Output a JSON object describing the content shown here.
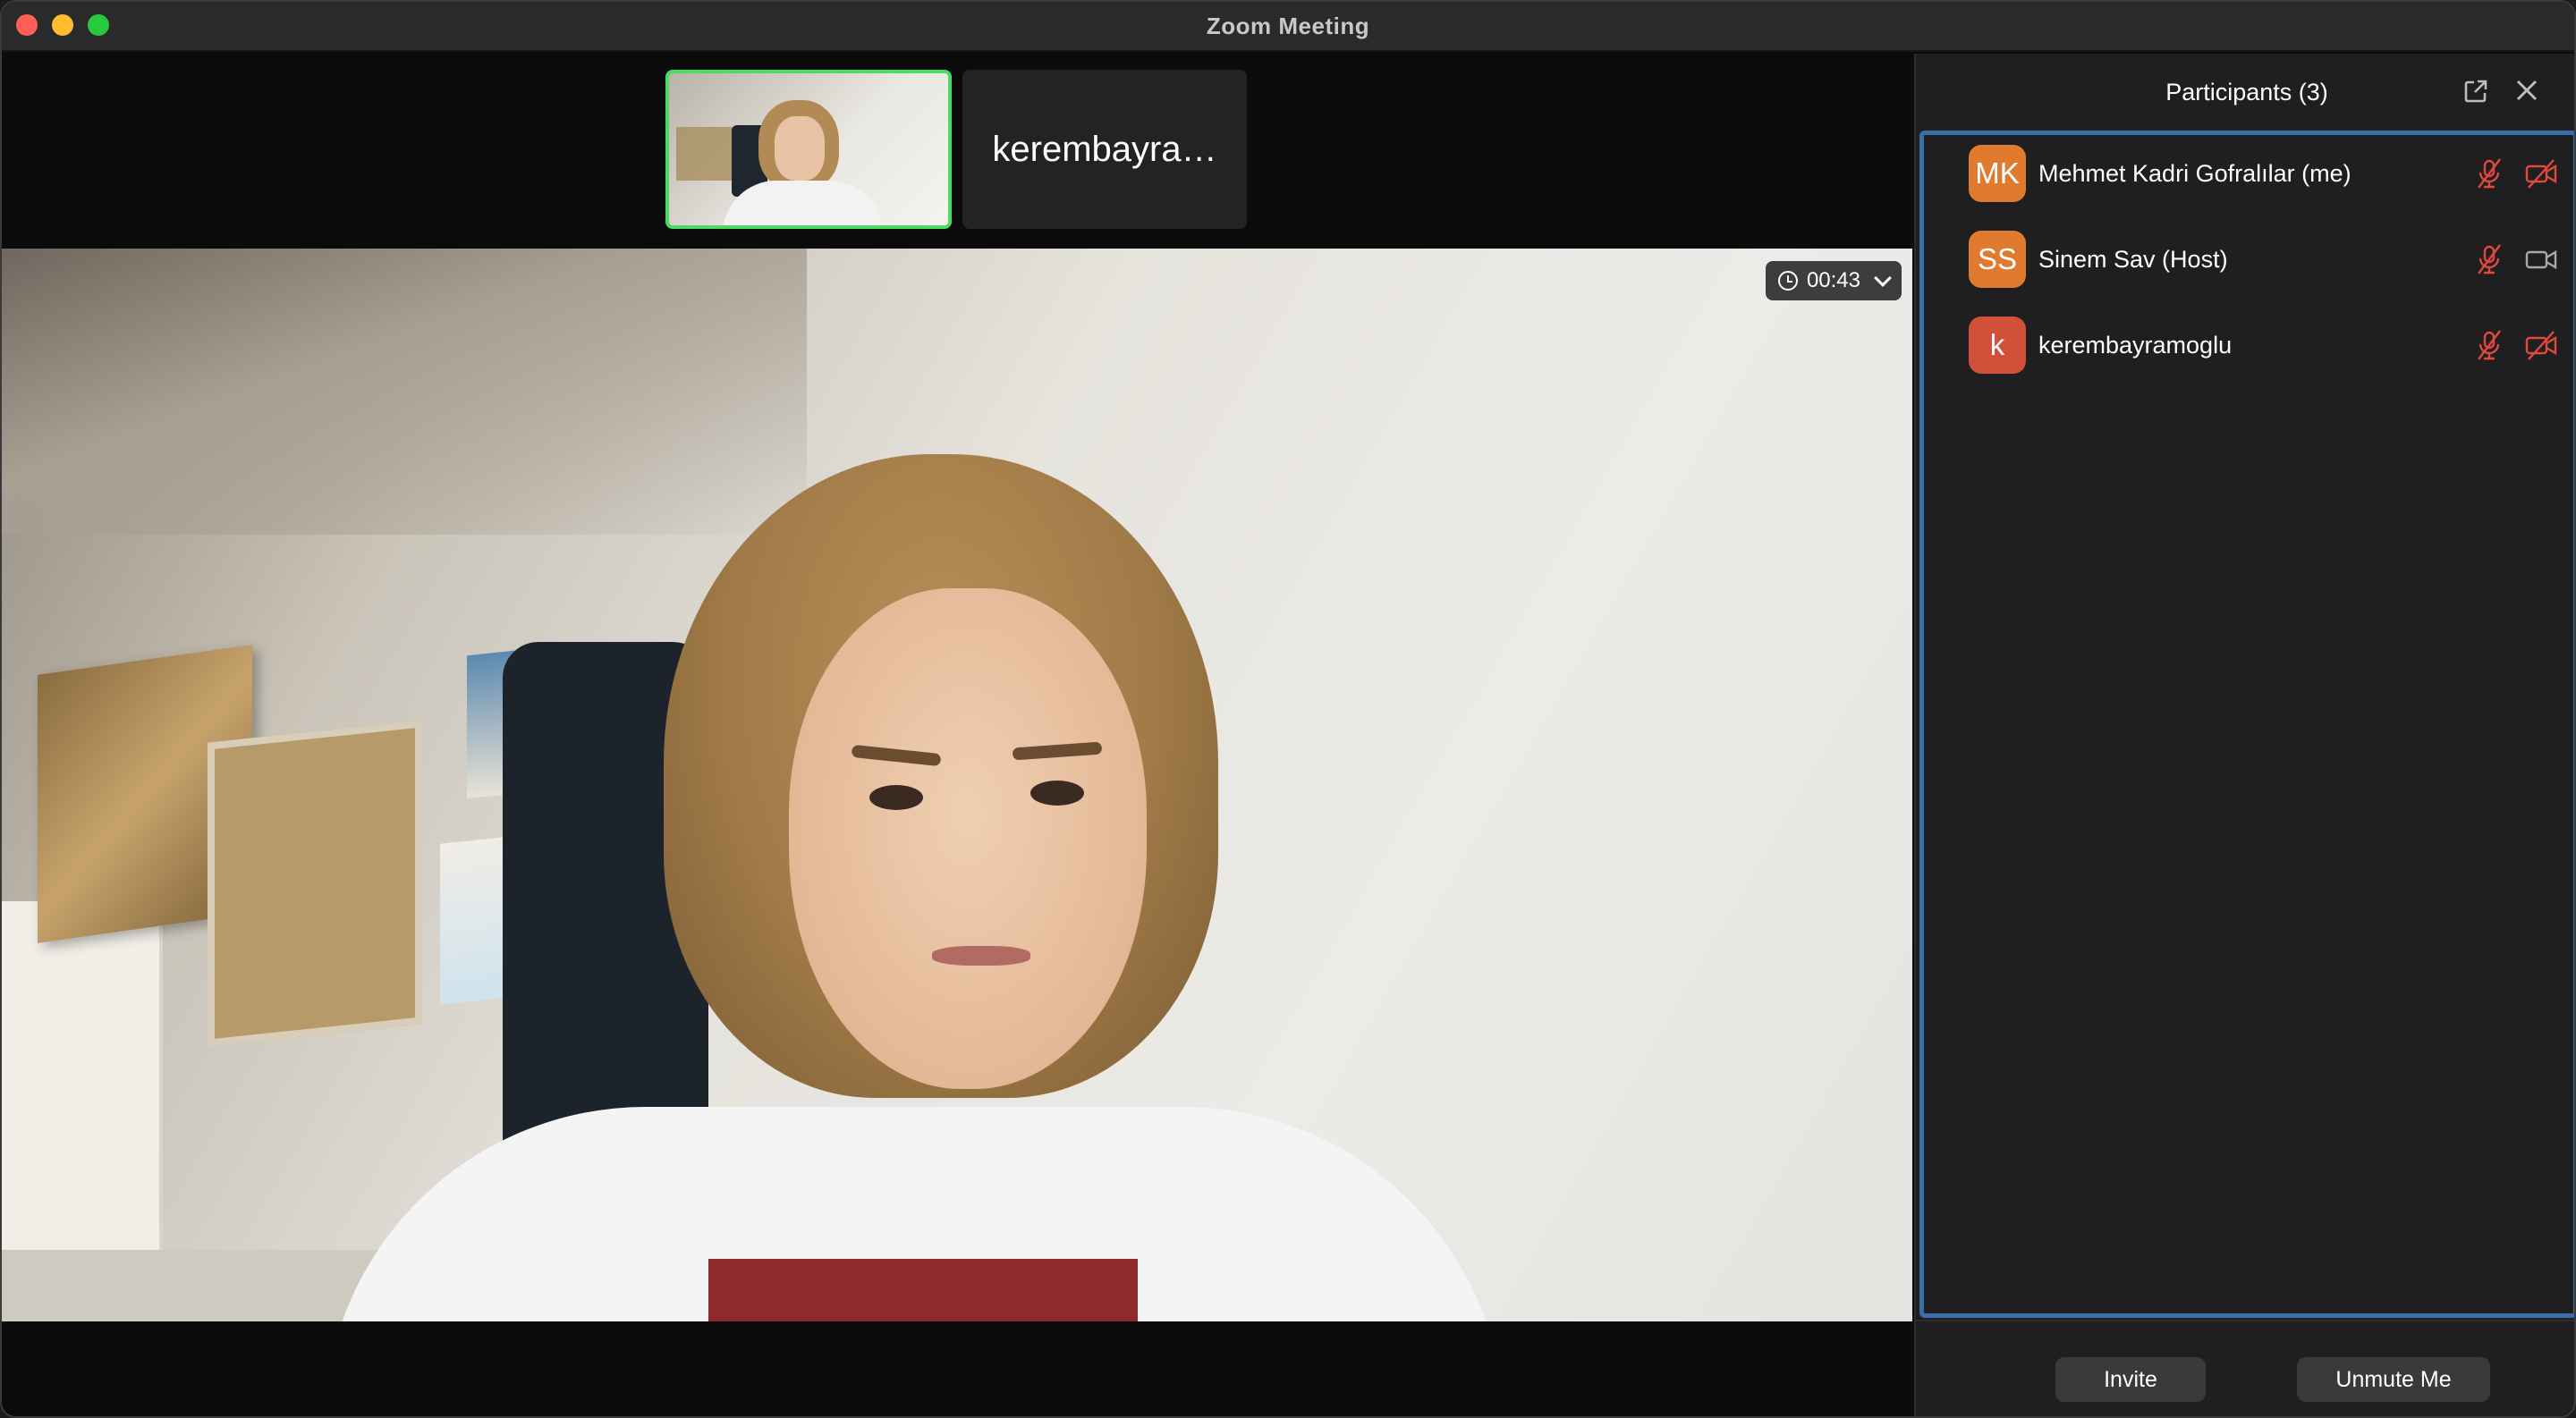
{
  "window": {
    "title": "Zoom Meeting"
  },
  "gallery": {
    "thumb_name": "kerembayra…"
  },
  "main_video": {
    "timer": "00:43"
  },
  "panel": {
    "title": "Participants (3)",
    "participants": [
      {
        "initials": "MK",
        "name": "Mehmet Kadri Gofralılar (me)",
        "avatar_color": "#e07a2e",
        "mic": "muted",
        "video": "off"
      },
      {
        "initials": "SS",
        "name": "Sinem Sav (Host)",
        "avatar_color": "#e07a2e",
        "mic": "muted",
        "video": "on"
      },
      {
        "initials": "k",
        "name": "kerembayramoglu",
        "avatar_color": "#d0503a",
        "mic": "muted",
        "video": "off"
      }
    ],
    "buttons": {
      "invite": "Invite",
      "unmute": "Unmute Me"
    }
  },
  "colors": {
    "active_speaker_border": "#4cd964",
    "list_focus_border": "#3b6ea8",
    "muted_icon": "#e0483b"
  }
}
